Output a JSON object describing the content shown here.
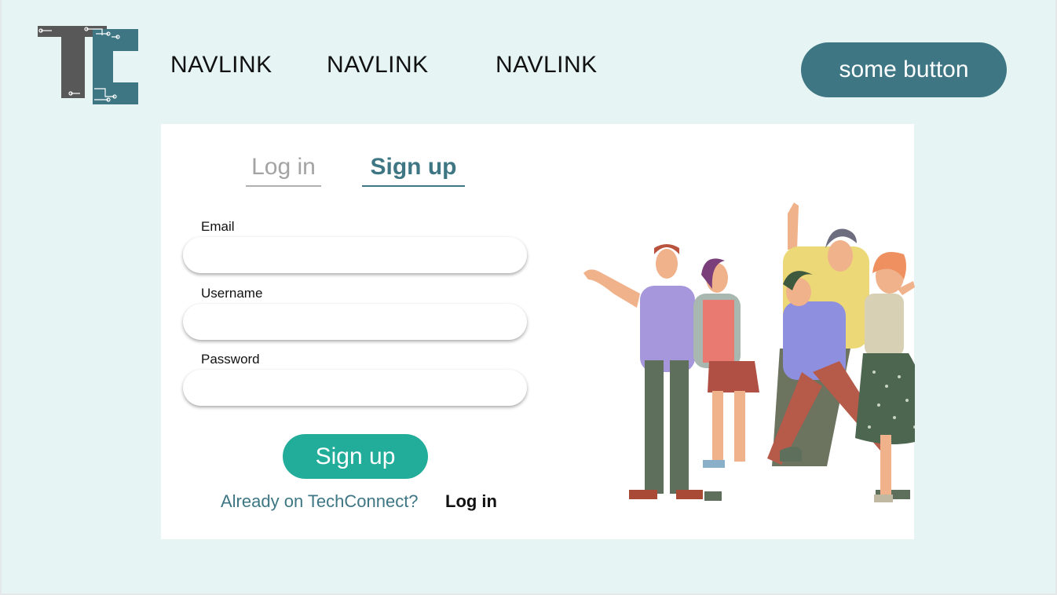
{
  "header": {
    "logo_name": "TechConnect logo",
    "nav_links": [
      "NAVLINK",
      "NAVLINK",
      "NAVLINK"
    ],
    "button_label": "some button"
  },
  "colors": {
    "background": "#e6f5f4",
    "primary_dark": "#3e7684",
    "accent_green": "#22ad9a",
    "logo_gray": "#585858"
  },
  "auth": {
    "tabs": [
      {
        "label": "Log in",
        "active": false
      },
      {
        "label": "Sign up",
        "active": true
      }
    ],
    "fields": [
      {
        "label": "Email",
        "value": "",
        "placeholder": ""
      },
      {
        "label": "Username",
        "value": "",
        "placeholder": ""
      },
      {
        "label": "Password",
        "value": "",
        "placeholder": ""
      }
    ],
    "submit_label": "Sign up",
    "already_text": "Already on TechConnect?",
    "login_link": "Log in"
  },
  "illustration": {
    "icon": "group-of-people-illustration"
  }
}
